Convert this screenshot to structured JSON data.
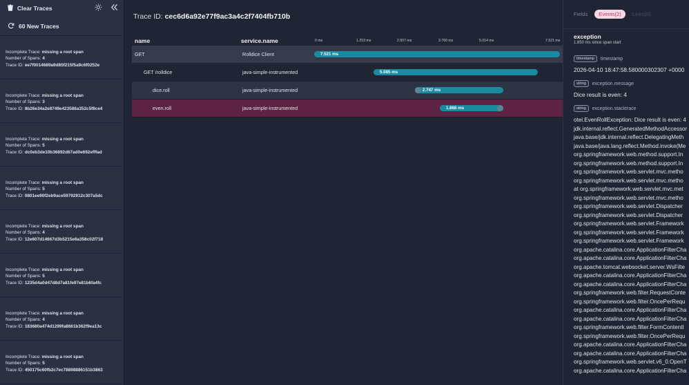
{
  "sidebar": {
    "clear_label": "Clear Traces",
    "new_traces_label": "60 New Traces",
    "traces": [
      {
        "prefix": "Incomplete Trace: ",
        "status": "missing a root span",
        "spans_label": "Number of Spans: ",
        "spans": "4",
        "id_label": "Trace ID: ",
        "id": "ee7f0014689a9d85f215f5a9c6f0252e"
      },
      {
        "prefix": "Incomplete Trace: ",
        "status": "missing a root span",
        "spans_label": "Number of Spans: ",
        "spans": "3",
        "id_label": "Trace ID: ",
        "id": "8b26e34a2e8749e423588a352c5f8ce4"
      },
      {
        "prefix": "Incomplete Trace: ",
        "status": "missing a root span",
        "spans_label": "Number of Spans: ",
        "spans": "5",
        "id_label": "Trace ID: ",
        "id": "dc0eb3de10b36892d67ad0e692efffad"
      },
      {
        "prefix": "Incomplete Trace: ",
        "status": "missing a root span",
        "spans_label": "Number of Spans: ",
        "spans": "5",
        "id_label": "Trace ID: ",
        "id": "0801ee90f2eb9ace59792912c307a5dc"
      },
      {
        "prefix": "Incomplete Trace: ",
        "status": "missing a root span",
        "spans_label": "Number of Spans: ",
        "spans": "4",
        "id_label": "Trace ID: ",
        "id": "12e607d14667d3b5215e6a358c02f718"
      },
      {
        "prefix": "Incomplete Trace: ",
        "status": "missing a root span",
        "spans_label": "Number of Spans: ",
        "spans": "5",
        "id_label": "Trace ID: ",
        "id": "1235d4a0d47d8d7a81fe97e81b6fa4fc"
      },
      {
        "prefix": "Incomplete Trace: ",
        "status": "missing a root span",
        "spans_label": "Number of Spans: ",
        "spans": "4",
        "id_label": "Trace ID: ",
        "id": "183680a474d1299fa8661b362f9ea13c"
      },
      {
        "prefix": "Incomplete Trace: ",
        "status": "missing a root span",
        "spans_label": "Number of Spans: ",
        "spans": "5",
        "id_label": "Trace ID: ",
        "id": "450175c60fb2c7ec78898886151b3863"
      }
    ]
  },
  "main": {
    "trace_label": "Trace ID: ",
    "trace_id": "cec6d6a92e77f9ac3a4c2f7404fb710b",
    "col_name": "name",
    "col_service": "service.name",
    "ticks": [
      "0 ms",
      "1.253 ms",
      "2.507 ms",
      "3.760 ms",
      "5.014 ms",
      "7.521 ms"
    ],
    "spans": [
      {
        "name": "GET",
        "service": "Rolldice Client",
        "duration": "7.521 ms"
      },
      {
        "name": "GET /rolldice",
        "service": "java-simple-instrumented",
        "duration": "5.085 ms"
      },
      {
        "name": "dice.roll",
        "service": "java-simple-instrumented",
        "duration": "2.747 ms"
      },
      {
        "name": "even.roll",
        "service": "java-simple-instrumented",
        "duration": "1.868 ms"
      }
    ]
  },
  "panel": {
    "tabs": [
      "Fields",
      "Events(2)",
      "Links(0)"
    ],
    "event_name": "exception",
    "event_time": "1.850 ms since span start",
    "attrs": [
      {
        "type": "timestamp",
        "key": "timestamp",
        "value": "2026-04-10 18:47:58.580000302307 +0000"
      },
      {
        "type": "string",
        "key": "exception.message",
        "value": "Dice result is even: 4"
      },
      {
        "type": "string",
        "key": "exception.stacktrace",
        "value": ""
      }
    ],
    "stacktrace": [
      "otel.EvenRollException: Dice result is even: 4",
      "jdk.internal.reflect.GeneratedMethodAccessor",
      "java.base/jdk.internal.reflect.DelegatingMeth",
      "java.base/java.lang.reflect.Method.invoke(Me",
      "org.springframework.web.method.support.In",
      "org.springframework.web.method.support.In",
      "org.springframework.web.servlet.mvc.metho",
      "org.springframework.web.servlet.mvc.metho",
      "at org.springframework.web.servlet.mvc.met",
      "org.springframework.web.servlet.mvc.metho",
      "org.springframework.web.servlet.Dispatcher",
      "org.springframework.web.servlet.Dispatcher",
      "org.springframework.web.servlet.Framework",
      "org.springframework.web.servlet.Framework",
      "org.springframework.web.servlet.Framework",
      "org.apache.catalina.core.ApplicationFilterCha",
      "org.apache.catalina.core.ApplicationFilterCha",
      "org.apache.tomcat.websocket.server.WsFilte",
      "org.apache.catalina.core.ApplicationFilterCha",
      "org.apache.catalina.core.ApplicationFilterCha",
      "org.springframework.web.filter.RequestConte",
      "org.springframework.web.filter.OncePerRequ",
      "org.apache.catalina.core.ApplicationFilterCha",
      "org.apache.catalina.core.ApplicationFilterCha",
      "org.springframework.web.filter.FormContentI",
      "org.springframework.web.filter.OncePerRequ",
      "org.apache.catalina.core.ApplicationFilterCha",
      "org.apache.catalina.core.ApplicationFilterCha",
      "org.springframework.web.servlet.v6_0.OpenT",
      "org.apache.catalina.core.ApplicationFilterCha"
    ]
  },
  "colors": {
    "bar": "#1a8aa1",
    "selected_row": "#5c2343",
    "root_row": "#343b4c",
    "alt_row": "#2c3445",
    "active_tab_bg": "#f7d7e4",
    "active_tab_fg": "#b73a6c"
  },
  "icons": [
    "trash-icon",
    "sun-icon",
    "collapse-left-icon",
    "refresh-icon"
  ]
}
